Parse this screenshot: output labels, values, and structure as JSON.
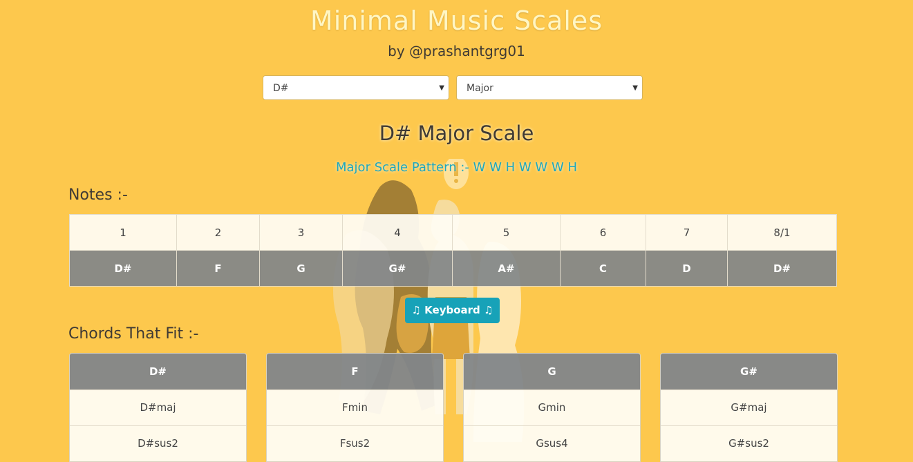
{
  "header": {
    "title": "Minimal Music Scales",
    "byline": "by @prashantgrg01"
  },
  "controls": {
    "key_select": {
      "value": "D#"
    },
    "scale_select": {
      "value": "Major"
    }
  },
  "scale": {
    "title": "D# Major Scale",
    "pattern_label": "Major Scale Pattern :- W W H W W W H"
  },
  "notes_section": {
    "label": "Notes :-",
    "degrees": [
      "1",
      "2",
      "3",
      "4",
      "5",
      "6",
      "7",
      "8/1"
    ],
    "notes": [
      "D#",
      "F",
      "G",
      "G#",
      "A#",
      "C",
      "D",
      "D#"
    ]
  },
  "keyboard_button": {
    "label": "♫ Keyboard ♫"
  },
  "chords_section": {
    "label": "Chords That Fit :-",
    "cards": [
      {
        "root": "D#",
        "chords": [
          "D#maj",
          "D#sus2"
        ]
      },
      {
        "root": "F",
        "chords": [
          "Fmin",
          "Fsus2"
        ]
      },
      {
        "root": "G",
        "chords": [
          "Gmin",
          "Gsus4"
        ]
      },
      {
        "root": "G#",
        "chords": [
          "G#maj",
          "G#sus2"
        ]
      }
    ]
  },
  "colors": {
    "background": "#fdc84d",
    "accent": "#17a2b8",
    "title": "#fff6c4",
    "table_header": "#82868a"
  }
}
